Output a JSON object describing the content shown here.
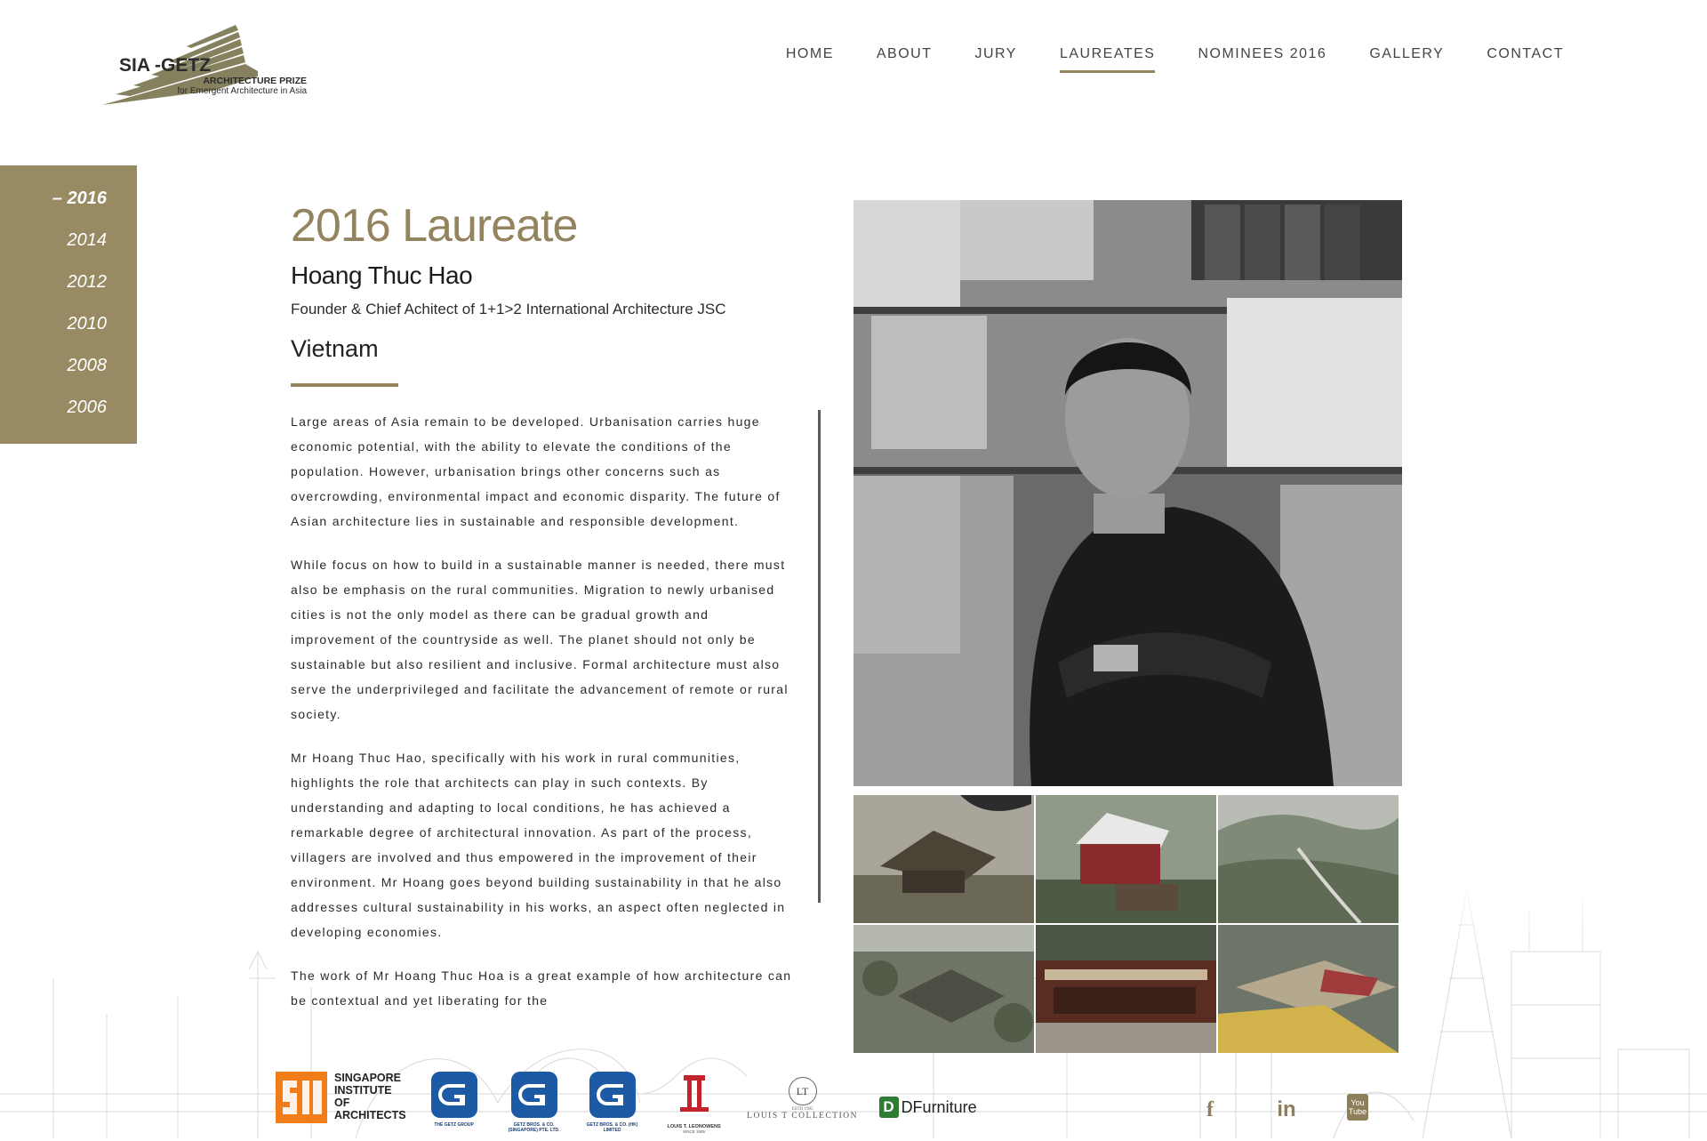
{
  "brand": {
    "line1": "SIA -GETZ",
    "line2": "ARCHITECTURE PRIZE",
    "line3": "for Emergent Architecture in Asia",
    "accent": "#988a62"
  },
  "nav": {
    "items": [
      {
        "label": "HOME"
      },
      {
        "label": "ABOUT"
      },
      {
        "label": "JURY"
      },
      {
        "label": "LAUREATES",
        "active": true
      },
      {
        "label": "NOMINEES 2016"
      },
      {
        "label": "GALLERY"
      },
      {
        "label": "CONTACT"
      }
    ]
  },
  "years": [
    "– 2016",
    "2014",
    "2012",
    "2010",
    "2008",
    "2006"
  ],
  "laureate": {
    "heading": "2016 Laureate",
    "name": "Hoang Thuc Hao",
    "role": "Founder & Chief Achitect of 1+1>2 International Architecture JSC",
    "country": "Vietnam",
    "paragraphs": [
      "Large areas of Asia remain to be developed. Urbanisation carries huge economic potential, with the ability to elevate the conditions of the population. However, urbanisation brings other concerns such as overcrowding, environmental impact and economic disparity. The future of Asian architecture lies in sustainable and responsible development.",
      "While focus on how to build in a sustainable manner is needed, there must also be emphasis on the rural communities. Migration to newly urbanised cities is not the only model as there can be gradual growth and improvement of the countryside as well. The planet should not only be sustainable but also resilient and inclusive. Formal architecture must also serve the underprivileged and facilitate the advancement of remote or rural society.",
      "Mr Hoang Thuc Hao, specifically with his work in rural communities, highlights the role that architects can play in such contexts. By understanding and adapting to local conditions, he has achieved a remarkable degree of architectural innovation. As part of the process, villagers are involved and thus empowered in the improvement of their environment. Mr Hoang goes beyond building sustainability in that he also addresses cultural sustainability in his works, an aspect often neglected in developing economies.",
      "The work of Mr Hoang Thuc Hoa is a great example of how architecture can be contextual and yet liberating for the"
    ]
  },
  "sponsors": {
    "sia": [
      "SINGAPORE",
      "INSTITUTE",
      "OF",
      "ARCHITECTS"
    ],
    "getz1": "THE GETZ GROUP",
    "getz2": "GETZ BROS. & CO. (SINGAPORE) PTE. LTD.",
    "getz3": "GETZ BROS. & CO. (HK) LIMITED",
    "leong": "LOUIS T. LEONOWENS",
    "leong_since": "SINCE 1905",
    "lt_mark": "LT",
    "lt_est": "ESTD 1905",
    "lt_name": "LOUIS T COLLECTION",
    "df_mark": "D",
    "df_name": "DFurniture"
  },
  "social": [
    "f",
    "in",
    "You Tube"
  ]
}
